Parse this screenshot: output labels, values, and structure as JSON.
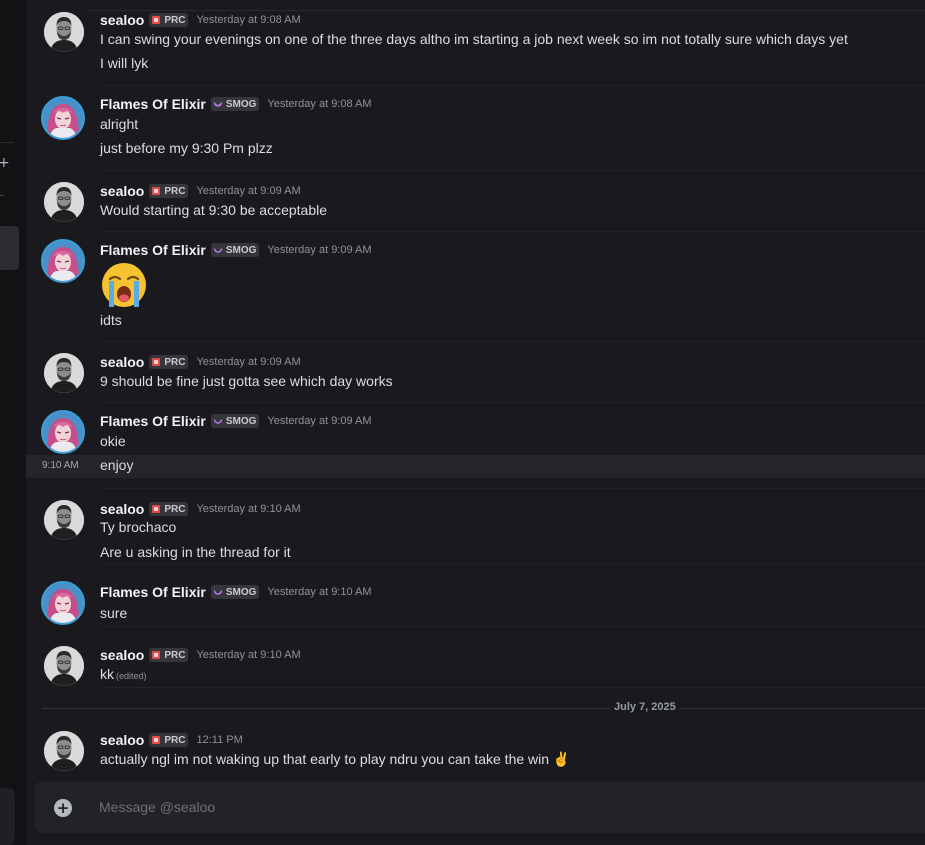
{
  "colors": {
    "background": "#1a1a1e",
    "prc_tag_icon": "#e04a4a",
    "smog_tag_icon": "#c27cf2",
    "flames_avatar_ring": "#3aa0d8"
  },
  "users": {
    "sealoo": {
      "name": "sealoo",
      "tag": "PRC",
      "tag_icon": "prc-badge-icon"
    },
    "flames": {
      "name": "Flames Of Elixir",
      "tag": "SMOG",
      "tag_icon": "crescent-moon-icon"
    }
  },
  "messages": [
    {
      "author": "sealoo",
      "timestamp": "Yesterday at 9:08 AM",
      "lines": [
        "I can swing your evenings on one of the three days altho im starting a job next week so im not totally sure which days yet",
        "I will lyk"
      ]
    },
    {
      "author": "Flames Of Elixir",
      "timestamp": "Yesterday at 9:08 AM",
      "lines": [
        "alright",
        "just before my 9:30 Pm plzz"
      ]
    },
    {
      "author": "sealoo",
      "timestamp": "Yesterday at 9:09 AM",
      "lines": [
        "Would starting at 9:30 be acceptable"
      ]
    },
    {
      "author": "Flames Of Elixir",
      "timestamp": "Yesterday at 9:09 AM",
      "emoji": "loudly-crying-face-emoji",
      "lines": [
        "idts"
      ]
    },
    {
      "author": "sealoo",
      "timestamp": "Yesterday at 9:09 AM",
      "lines": [
        "9 should be fine just gotta see which day works"
      ]
    },
    {
      "author": "Flames Of Elixir",
      "timestamp": "Yesterday at 9:09 AM",
      "lines": [
        "okie",
        "enjoy"
      ],
      "hover_time": "9:10 AM"
    },
    {
      "author": "sealoo",
      "timestamp": "Yesterday at 9:10 AM",
      "lines": [
        "Ty brochaco",
        "Are u asking in the thread for it"
      ]
    },
    {
      "author": "Flames Of Elixir",
      "timestamp": "Yesterday at 9:10 AM",
      "lines": [
        "sure"
      ]
    },
    {
      "author": "sealoo",
      "timestamp": "Yesterday at 9:10 AM",
      "lines": [
        "kk"
      ],
      "edited": "(edited)"
    },
    {
      "author": "sealoo",
      "timestamp": "12:11 PM",
      "lines": [
        "actually ngl im not waking up that early to play ndru you can take the win ✌️"
      ]
    }
  ],
  "date_divider": "July 7, 2025",
  "composer": {
    "placeholder": "Message @sealoo"
  }
}
